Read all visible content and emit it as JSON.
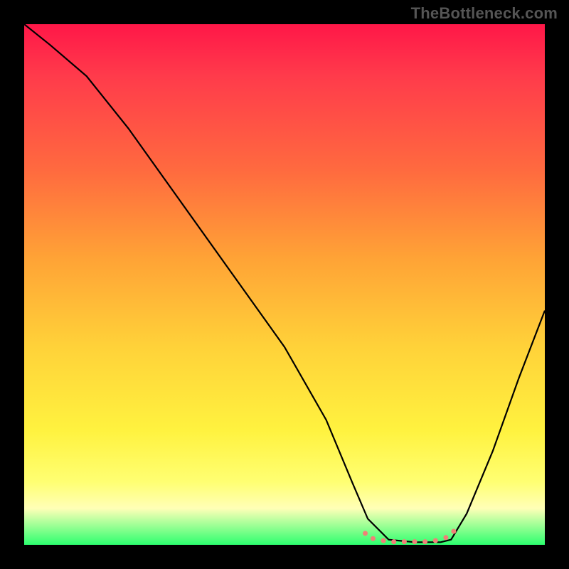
{
  "watermark": "TheBottleneck.com",
  "chart_data": {
    "type": "line",
    "title": "",
    "xlabel": "",
    "ylabel": "",
    "xlim": [
      0,
      100
    ],
    "ylim": [
      0,
      100
    ],
    "grid": false,
    "legend": false,
    "background_gradient": {
      "orientation": "vertical",
      "stops": [
        {
          "pos": 0.0,
          "color": "#ff1748"
        },
        {
          "pos": 0.1,
          "color": "#ff3b4b"
        },
        {
          "pos": 0.28,
          "color": "#ff6a3f"
        },
        {
          "pos": 0.45,
          "color": "#ffa336"
        },
        {
          "pos": 0.62,
          "color": "#ffd239"
        },
        {
          "pos": 0.78,
          "color": "#fff23f"
        },
        {
          "pos": 0.88,
          "color": "#ffff73"
        },
        {
          "pos": 0.93,
          "color": "#ffffb7"
        },
        {
          "pos": 1.0,
          "color": "#2dff6f"
        }
      ]
    },
    "series": [
      {
        "name": "bottleneck-curve",
        "color": "#000000",
        "stroke_width": 2,
        "x": [
          0,
          5,
          12,
          20,
          30,
          40,
          50,
          58,
          63,
          66,
          70,
          75,
          80,
          82,
          85,
          90,
          95,
          100
        ],
        "y": [
          100,
          96,
          90,
          80,
          66,
          52,
          38,
          24,
          12,
          5,
          1,
          0.5,
          0.5,
          1,
          6,
          18,
          32,
          45
        ]
      }
    ],
    "annotations": [
      {
        "name": "valley-dots",
        "type": "scatter",
        "color": "#f08077",
        "marker_size": 7,
        "x": [
          65.5,
          67,
          69,
          71,
          73,
          75,
          77,
          79,
          81,
          82.5
        ],
        "y": [
          2.2,
          1.2,
          0.8,
          0.6,
          0.6,
          0.6,
          0.6,
          0.8,
          1.4,
          2.6
        ]
      }
    ]
  }
}
